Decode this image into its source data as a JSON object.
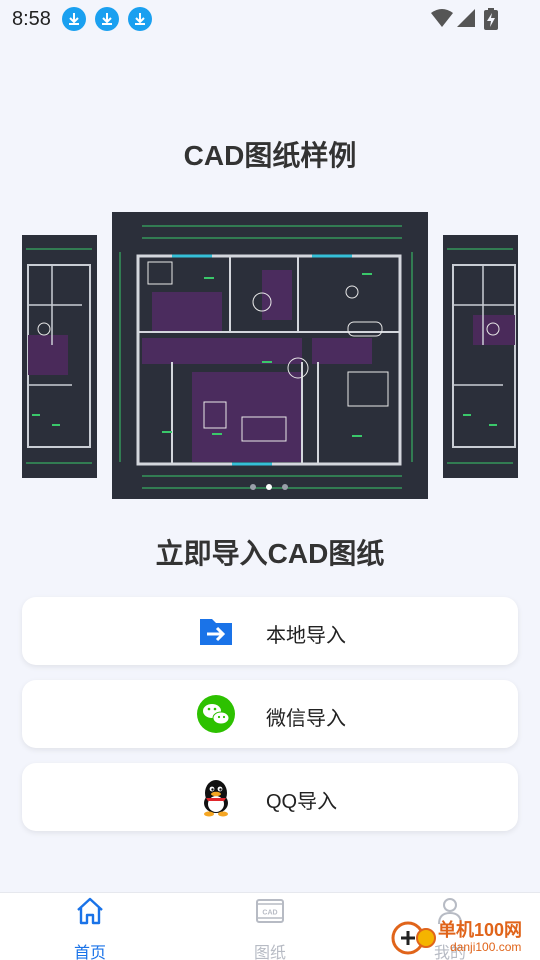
{
  "status_bar": {
    "time": "8:58",
    "download_icons": [
      "download-icon",
      "download-icon",
      "download-icon"
    ],
    "right_icons": [
      "wifi-icon",
      "cell-signal-icon",
      "battery-charging-icon"
    ]
  },
  "samples": {
    "title": "CAD图纸样例",
    "carousel_count": 3,
    "current_index": 1
  },
  "import": {
    "title": "立即导入CAD图纸",
    "buttons": [
      {
        "label": "本地导入",
        "icon": "folder-import-icon"
      },
      {
        "label": "微信导入",
        "icon": "wechat-icon"
      },
      {
        "label": "QQ导入",
        "icon": "qq-icon"
      }
    ]
  },
  "bottom_nav": {
    "items": [
      {
        "label": "首页",
        "icon": "home-icon",
        "active": true
      },
      {
        "label": "图纸",
        "icon": "cad-drawing-icon",
        "active": false
      },
      {
        "label": "我的",
        "icon": "user-icon",
        "active": false
      }
    ]
  },
  "watermark": {
    "brand": "单机100网",
    "url": "danji100.com"
  },
  "colors": {
    "accent": "#1a73e8",
    "background": "#f3f5fc",
    "download_badge": "#1aa0f0",
    "wechat": "#2dc100",
    "folder": "#1a73e8",
    "cad_bg": "#2b2f3a"
  }
}
